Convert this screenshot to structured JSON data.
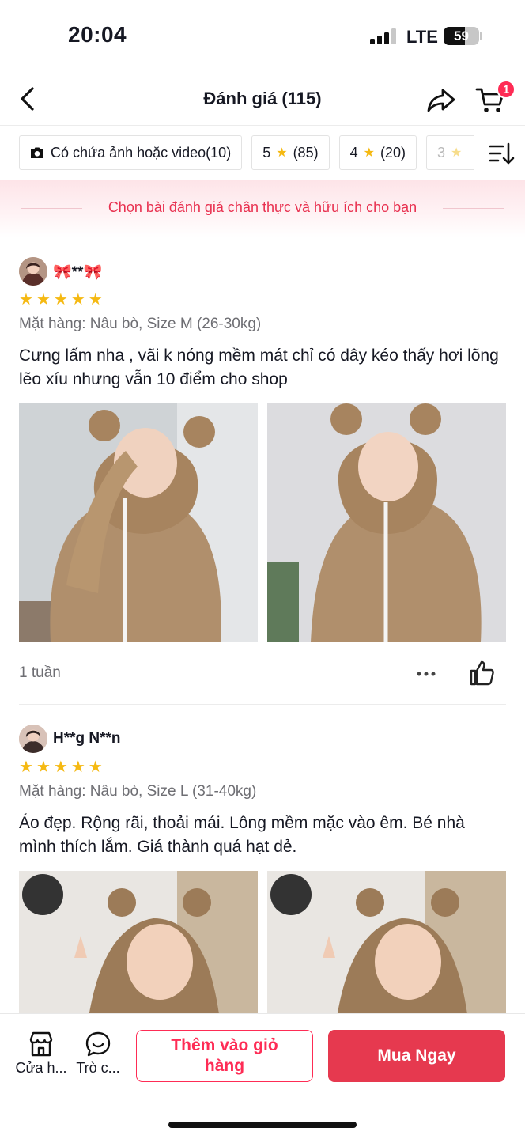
{
  "status_bar": {
    "time": "20:04",
    "network": "LTE",
    "battery": "59",
    "battery_level": 0.59
  },
  "header": {
    "title": "Đánh giá (115)",
    "cart_count": "1"
  },
  "filters": [
    {
      "label": "Có chứa ảnh hoặc video(10)",
      "icon": "camera-icon"
    },
    {
      "rating": "5",
      "count": "(85)"
    },
    {
      "rating": "4",
      "count": "(20)"
    },
    {
      "rating": "3",
      "count": ""
    }
  ],
  "banner": {
    "text": "Chọn bài đánh giá chân thực và hữu ích cho bạn"
  },
  "reviews": [
    {
      "name": "🎀**🎀",
      "rating": 5,
      "variant": "Mặt hàng: Nâu bò, Size M (26-30kg)",
      "text": "Cưng lấm nha , vãi k nóng mềm mát chỉ có dây kéo thấy hơi lõng lẽo xíu nhưng vẫn 10 điểm cho shop",
      "time": "1 tuần"
    },
    {
      "name": "H**g N**n",
      "rating": 5,
      "variant": "Mặt hàng: Nâu bò, Size L (31-40kg)",
      "text": "Áo đẹp. Rộng rãi, thoải mái. Lông mềm mặc vào êm. Bé nhà mình thích lắm. Giá thành quá hạt dẻ."
    }
  ],
  "bottom_bar": {
    "shop_label": "Cửa h...",
    "chat_label": "Trò c...",
    "add_to_cart": "Thêm vào giỏ hàng",
    "buy_now": "Mua Ngay"
  },
  "colors": {
    "accent": "#fe2c55",
    "buy_button": "#e6394f",
    "star": "#f5b912",
    "banner_text": "#e8304f"
  }
}
